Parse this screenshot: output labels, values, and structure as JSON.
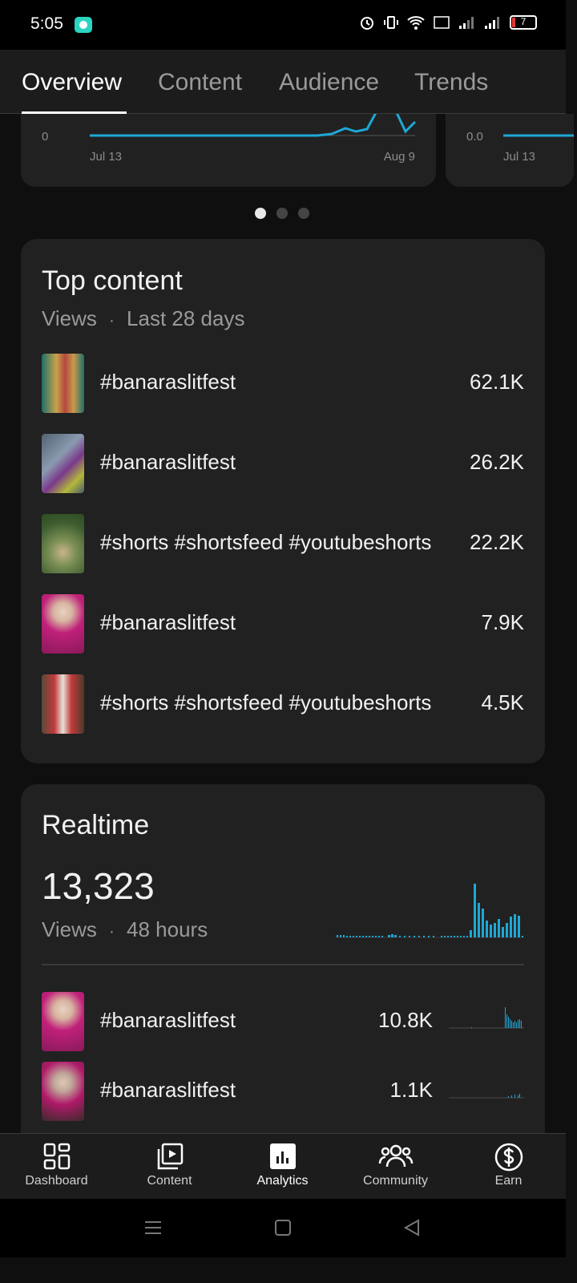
{
  "status": {
    "time": "5:05",
    "battery": "7"
  },
  "tabs": [
    {
      "label": "Overview"
    },
    {
      "label": "Content"
    },
    {
      "label": "Audience"
    },
    {
      "label": "Trends"
    }
  ],
  "charts": {
    "first": {
      "y_zero": "0",
      "x_start": "Jul 13",
      "x_end": "Aug 9"
    },
    "second": {
      "y_zero": "0.0",
      "x_start": "Jul 13"
    }
  },
  "top_content": {
    "title": "Top content",
    "metric": "Views",
    "separator": "·",
    "period": "Last 28 days",
    "items": [
      {
        "title": "#banaraslitfest",
        "value": "62.1K"
      },
      {
        "title": "#banaraslitfest",
        "value": "26.2K"
      },
      {
        "title": "#shorts #shortsfeed #youtubeshorts",
        "value": "22.2K"
      },
      {
        "title": "#banaraslitfest",
        "value": "7.9K"
      },
      {
        "title": "#shorts #shortsfeed #youtubeshorts",
        "value": "4.5K"
      }
    ]
  },
  "realtime": {
    "title": "Realtime",
    "total": "13,323",
    "metric": "Views",
    "separator": "·",
    "period": "48 hours",
    "items": [
      {
        "title": "#banaraslitfest",
        "value": "10.8K"
      },
      {
        "title": "#banaraslitfest",
        "value": "1.1K"
      }
    ]
  },
  "bottom_nav": [
    {
      "label": "Dashboard",
      "icon": "dashboard-icon"
    },
    {
      "label": "Content",
      "icon": "content-icon"
    },
    {
      "label": "Analytics",
      "icon": "analytics-icon"
    },
    {
      "label": "Community",
      "icon": "community-icon"
    },
    {
      "label": "Earn",
      "icon": "earn-icon"
    }
  ],
  "colors": {
    "accent": "#1ea7d6",
    "card": "#212121",
    "background": "#0f0f0f"
  }
}
